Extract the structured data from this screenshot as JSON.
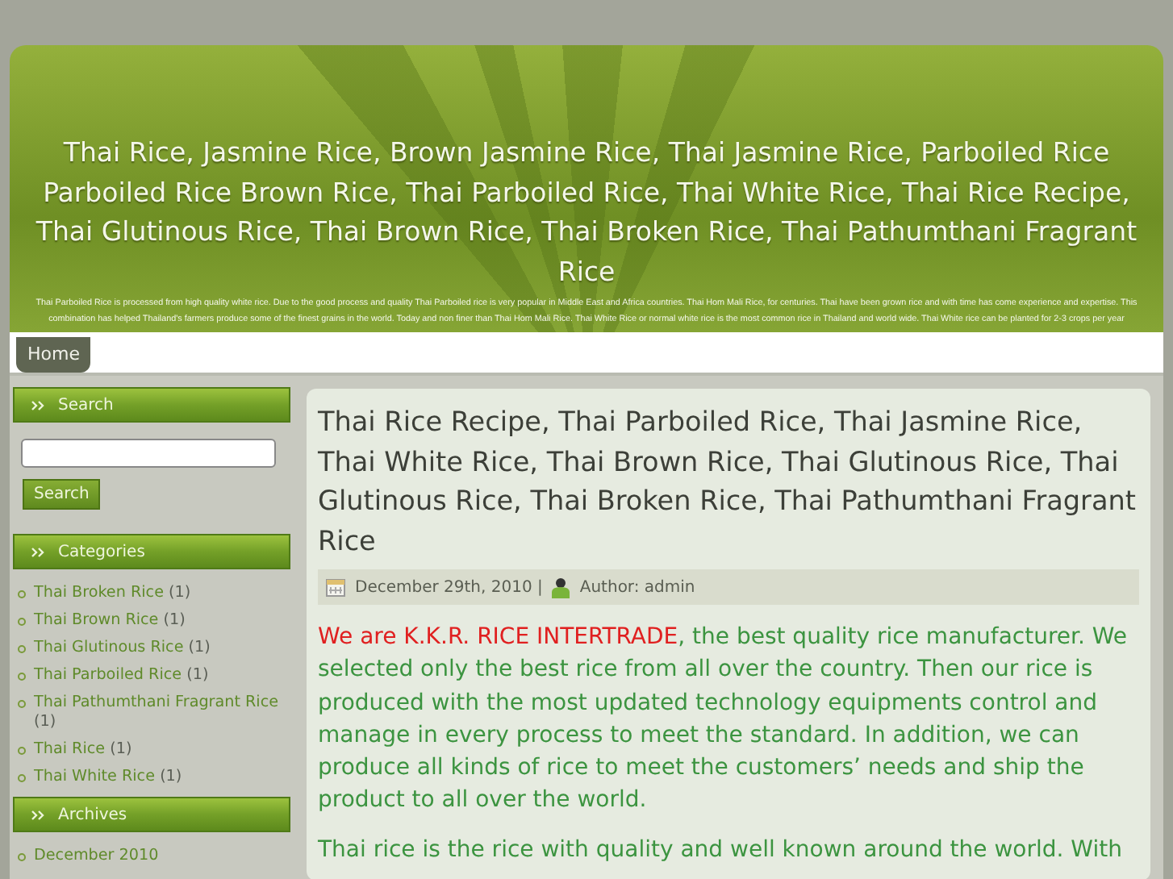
{
  "header": {
    "title_lines": [
      "Thai Rice, Jasmine Rice, Brown Jasmine Rice, Thai Jasmine Rice, Parboiled Rice",
      "Parboiled Rice Brown Rice, Thai Parboiled Rice, Thai White Rice, Thai Rice Recipe,",
      "Thai Glutinous Rice, Thai Brown Rice, Thai Broken Rice, Thai Pathumthani Fragrant",
      "Rice"
    ],
    "description": "Thai Parboiled Rice is processed from high quality white rice. Due to the good process and quality Thai Parboiled rice is very popular in Middle East and Africa countries. Thai Hom Mali Rice, for centuries. Thai have been grown rice and with time has come experience and expertise. This combination has helped Thailand's farmers produce some of the finest grains in the world. Today and non finer than Thai Hom Mali Rice. Thai White Rice or normal white rice is the most common rice in Thailand and world wide. Thai White rice can be planted for 2-3 crops per year"
  },
  "nav": [
    {
      "label": "Home",
      "selected": true
    }
  ],
  "sidebar": {
    "search": {
      "title": "Search",
      "button": "Search"
    },
    "categories": {
      "title": "Categories",
      "items": [
        {
          "label": "Thai Broken Rice",
          "count": "(1)"
        },
        {
          "label": "Thai Brown Rice",
          "count": "(1)"
        },
        {
          "label": "Thai Glutinous Rice",
          "count": "(1)"
        },
        {
          "label": "Thai Parboiled Rice",
          "count": "(1)"
        },
        {
          "label": "Thai Pathumthani Fragrant Rice",
          "count": "(1)"
        },
        {
          "label": "Thai Rice",
          "count": "(1)"
        },
        {
          "label": "Thai White Rice",
          "count": "(1)"
        }
      ]
    },
    "archives": {
      "title": "Archives",
      "items": [
        {
          "label": "December 2010"
        }
      ]
    }
  },
  "post": {
    "title": "Thai Rice Recipe, Thai Parboiled Rice, Thai Jasmine Rice, Thai White Rice, Thai Brown Rice, Thai Glutinous Rice, Thai Glutinous Rice, Thai Broken Rice, Thai Pathumthani Fragrant Rice",
    "date": "December 29th, 2010 |",
    "author": "Author: admin",
    "paragraphs": [
      [
        {
          "kind": "highlight",
          "text": "We are K.K.R. RICE INTERTRADE"
        },
        {
          "kind": "normal",
          "text": ", the best quality rice manufacturer. We selected only the best rice from all over the country. Then our rice is produced with the most updated technology equipments control and manage in every process to meet the standard. In addition, we can produce all kinds of rice to meet the customers’ needs and ship the product to all over the world."
        }
      ],
      [
        {
          "kind": "normal",
          "text": "Thai rice is the rice with quality and well known around the world. With"
        }
      ]
    ]
  }
}
